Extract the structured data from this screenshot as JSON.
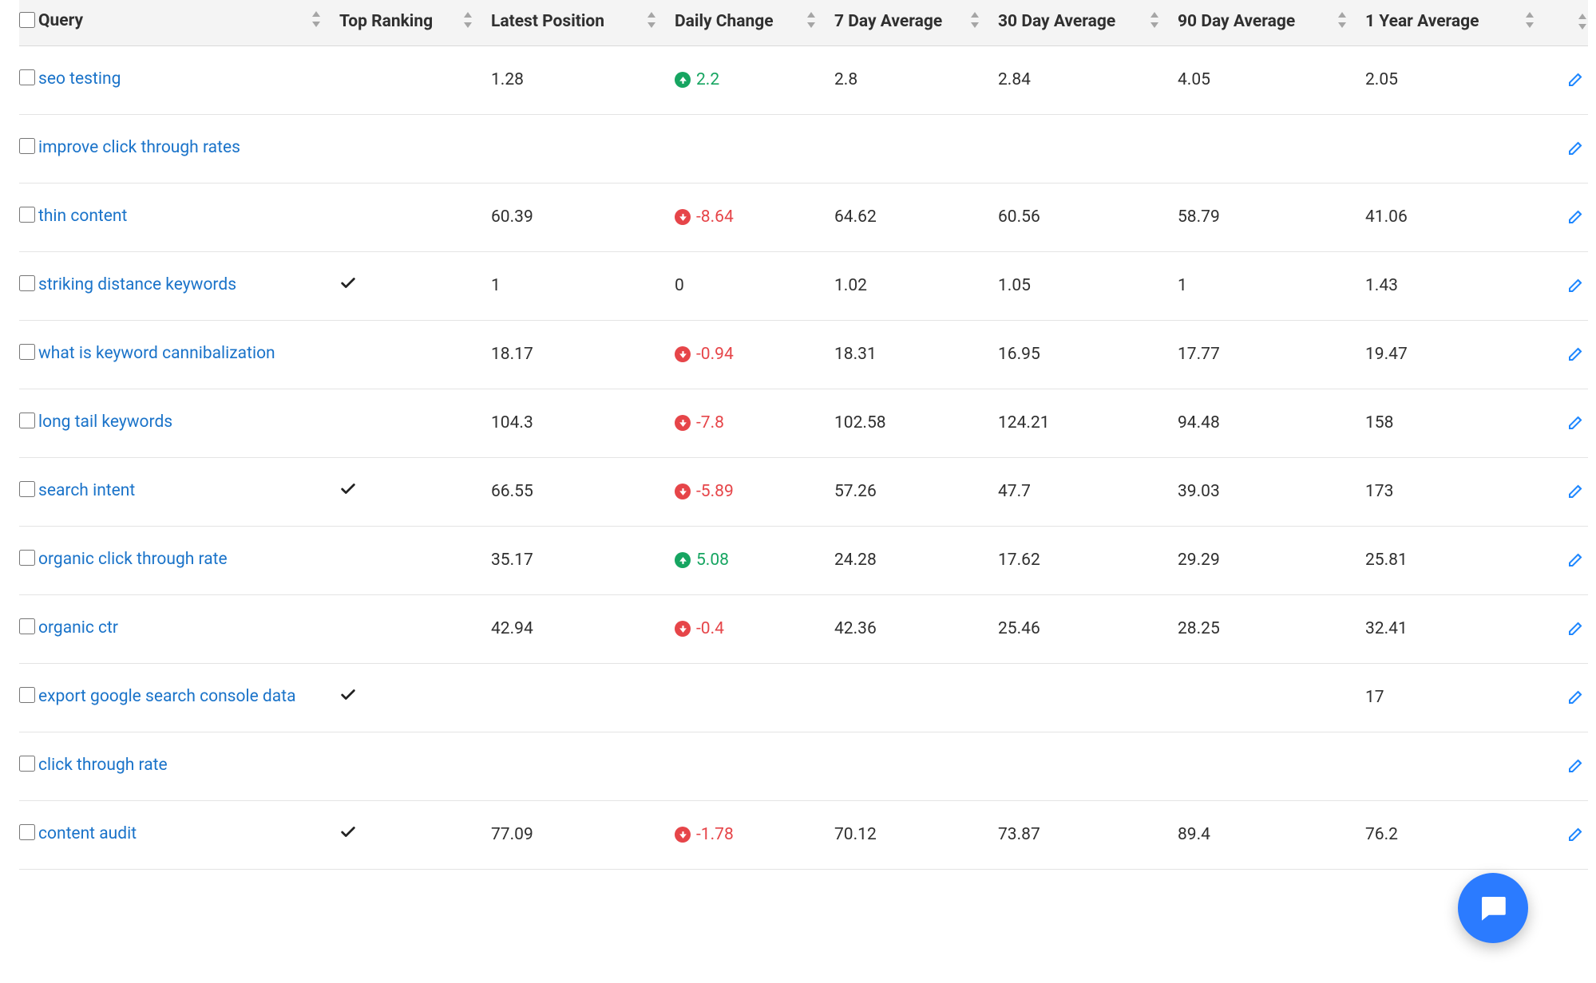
{
  "colors": {
    "link": "#1a73c9",
    "up": "#16a561",
    "down": "#e64549",
    "edit": "#1e87ff",
    "chat": "#2b7bff"
  },
  "columns": {
    "query": "Query",
    "top": "Top Ranking",
    "latest": "Latest Position",
    "daily": "Daily Change",
    "d7": "7 Day Average",
    "d30": "30 Day Average",
    "d90": "90 Day Average",
    "y1": "1 Year Average"
  },
  "rows": [
    {
      "query": "seo testing",
      "top": false,
      "latest": "1.28",
      "daily": {
        "dir": "up",
        "val": "2.2"
      },
      "d7": "2.8",
      "d30": "2.84",
      "d90": "4.05",
      "y1": "2.05"
    },
    {
      "query": "improve click through rates",
      "top": false,
      "latest": "",
      "daily": null,
      "d7": "",
      "d30": "",
      "d90": "",
      "y1": ""
    },
    {
      "query": "thin content",
      "top": false,
      "latest": "60.39",
      "daily": {
        "dir": "down",
        "val": "-8.64"
      },
      "d7": "64.62",
      "d30": "60.56",
      "d90": "58.79",
      "y1": "41.06"
    },
    {
      "query": "striking distance keywords",
      "top": true,
      "latest": "1",
      "daily": {
        "dir": "none",
        "val": "0"
      },
      "d7": "1.02",
      "d30": "1.05",
      "d90": "1",
      "y1": "1.43"
    },
    {
      "query": "what is keyword cannibalization",
      "top": false,
      "latest": "18.17",
      "daily": {
        "dir": "down",
        "val": "-0.94"
      },
      "d7": "18.31",
      "d30": "16.95",
      "d90": "17.77",
      "y1": "19.47"
    },
    {
      "query": "long tail keywords",
      "top": false,
      "latest": "104.3",
      "daily": {
        "dir": "down",
        "val": "-7.8"
      },
      "d7": "102.58",
      "d30": "124.21",
      "d90": "94.48",
      "y1": "158"
    },
    {
      "query": "search intent",
      "top": true,
      "latest": "66.55",
      "daily": {
        "dir": "down",
        "val": "-5.89"
      },
      "d7": "57.26",
      "d30": "47.7",
      "d90": "39.03",
      "y1": "173"
    },
    {
      "query": "organic click through rate",
      "top": false,
      "latest": "35.17",
      "daily": {
        "dir": "up",
        "val": "5.08"
      },
      "d7": "24.28",
      "d30": "17.62",
      "d90": "29.29",
      "y1": "25.81"
    },
    {
      "query": "organic ctr",
      "top": false,
      "latest": "42.94",
      "daily": {
        "dir": "down",
        "val": "-0.4"
      },
      "d7": "42.36",
      "d30": "25.46",
      "d90": "28.25",
      "y1": "32.41"
    },
    {
      "query": "export google search console data",
      "top": true,
      "latest": "",
      "daily": null,
      "d7": "",
      "d30": "",
      "d90": "",
      "y1": "17"
    },
    {
      "query": "click through rate",
      "top": false,
      "latest": "",
      "daily": null,
      "d7": "",
      "d30": "",
      "d90": "",
      "y1": ""
    },
    {
      "query": "content audit",
      "top": true,
      "latest": "77.09",
      "daily": {
        "dir": "down",
        "val": "-1.78"
      },
      "d7": "70.12",
      "d30": "73.87",
      "d90": "89.4",
      "y1": "76.2"
    }
  ],
  "icons": {
    "checkmark": "check-icon",
    "arrow_up": "arrow-up-circle-icon",
    "arrow_down": "arrow-down-circle-icon",
    "edit": "edit-icon",
    "sort": "sort-updown-icon",
    "chat": "chat-bubble-icon"
  }
}
